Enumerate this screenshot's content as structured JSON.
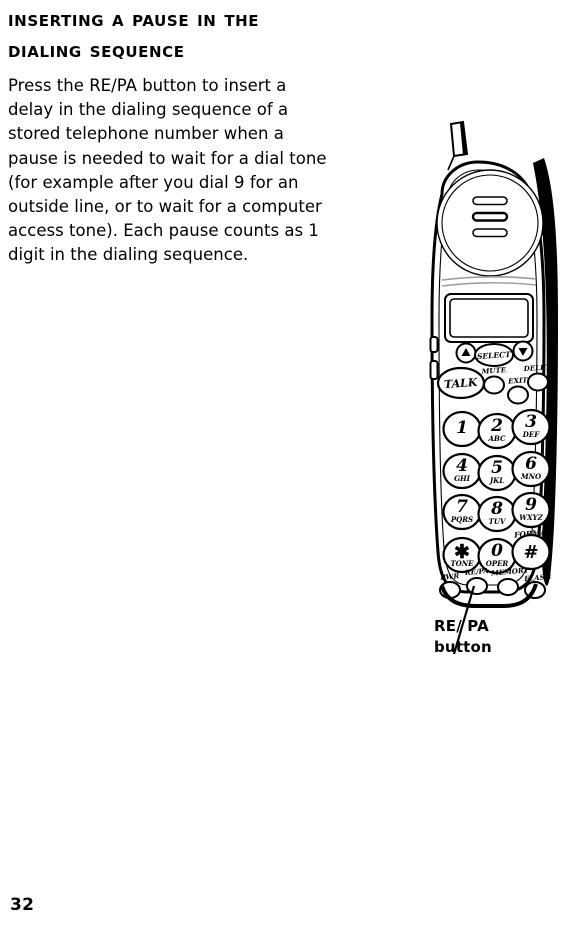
{
  "page": {
    "number": "32",
    "background_color": "#ffffff",
    "text_color": "#000000"
  },
  "heading": {
    "line1": "Inserting a Pause in the",
    "line2": "Dialing Sequence"
  },
  "body": {
    "paragraph": "Press the RE/PA button to insert a delay in the dialing sequence of a stored telephone number when a pause is needed to wait for a dial tone (for example after you dial 9 for an outside line, or to wait for a computer access tone).  Each pause counts as 1 digit in the dialing sequence."
  },
  "figure": {
    "alt_name": "cordless-telephone-handset",
    "callout_label": "RE/ PA\nbutton",
    "antenna": "antenna-stub",
    "earpiece": {
      "name": "earpiece-speaker",
      "slot_count": 3
    },
    "display": {
      "name": "lcd-display",
      "value": ""
    },
    "nav_buttons": [
      {
        "name": "scroll-up-button",
        "label": "▲"
      },
      {
        "name": "select-button",
        "label": "SELECT"
      },
      {
        "name": "scroll-down-button",
        "label": "▼"
      }
    ],
    "function_buttons": [
      {
        "name": "talk-button",
        "label": "TALK"
      },
      {
        "name": "mute-button",
        "label": "MUTE"
      },
      {
        "name": "exit-button",
        "label": "EXIT"
      },
      {
        "name": "delete-button",
        "label": "DELETE"
      }
    ],
    "side_buttons": [
      {
        "name": "volume-up-side-button"
      },
      {
        "name": "volume-down-side-button"
      }
    ],
    "keypad": [
      {
        "digit": "1",
        "letters": ""
      },
      {
        "digit": "2",
        "letters": "ABC"
      },
      {
        "digit": "3",
        "letters": "DEF"
      },
      {
        "digit": "4",
        "letters": "GHI"
      },
      {
        "digit": "5",
        "letters": "JKL"
      },
      {
        "digit": "6",
        "letters": "MNO"
      },
      {
        "digit": "7",
        "letters": "PQRS"
      },
      {
        "digit": "8",
        "letters": "TUV"
      },
      {
        "digit": "9",
        "letters": "WXYZ"
      },
      {
        "digit": "✳",
        "letters": "TONE"
      },
      {
        "digit": "0",
        "letters": "OPER"
      },
      {
        "digit": "#",
        "letters": ""
      }
    ],
    "format_label": "FORMAT",
    "bottom_buttons": [
      {
        "name": "pwr-button",
        "label": "PWR"
      },
      {
        "name": "repa-button",
        "label": "RE/PA"
      },
      {
        "name": "memory-button",
        "label": "MEMORY"
      },
      {
        "name": "flash-button",
        "label": "FLASH"
      }
    ]
  }
}
